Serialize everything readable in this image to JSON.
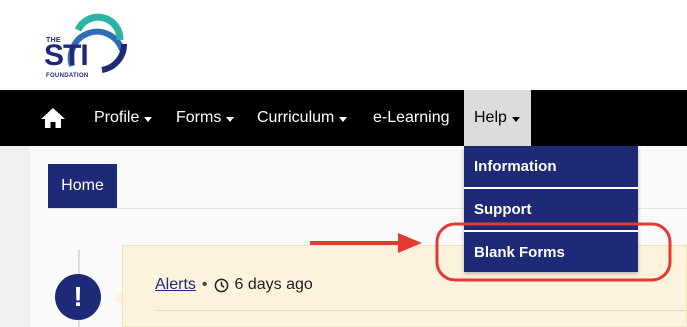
{
  "logo": {
    "the": "THE",
    "name": "STI",
    "foundation": "FOUNDATION"
  },
  "navbar": {
    "home_icon": "home-icon",
    "items": [
      {
        "label": "Profile",
        "has_caret": true
      },
      {
        "label": "Forms",
        "has_caret": true
      },
      {
        "label": "Curriculum",
        "has_caret": true
      },
      {
        "label": "e-Learning",
        "has_caret": false
      },
      {
        "label": "Help",
        "has_caret": true,
        "active": true
      }
    ]
  },
  "help_menu": {
    "items": [
      {
        "label": "Information"
      },
      {
        "label": "Support"
      },
      {
        "label": "Blank Forms",
        "highlighted": true
      }
    ]
  },
  "page": {
    "home_tab": "Home"
  },
  "alert": {
    "icon_glyph": "!",
    "link_label": "Alerts",
    "separator": "•",
    "time_ago": "6 days ago",
    "clock_icon": "clock-icon"
  },
  "colors": {
    "brand_navy": "#1e2a78",
    "navbar": "#000000",
    "annotation_red": "#e53935",
    "alert_bg": "#fcf3dd",
    "logo_teal": "#2bb3a3",
    "logo_blue": "#2f6db5"
  }
}
